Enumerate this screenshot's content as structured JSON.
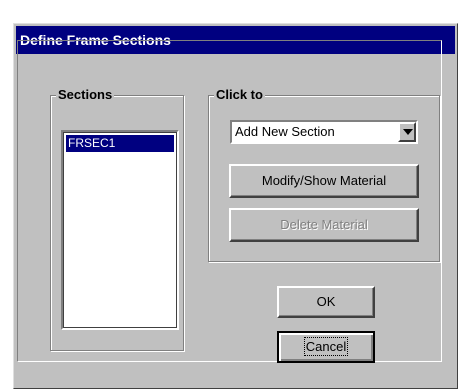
{
  "window": {
    "title": "Define Frame Sections"
  },
  "sections": {
    "label": "Sections",
    "items": [
      "FRSEC1"
    ],
    "selected": "FRSEC1"
  },
  "click_to": {
    "label": "Click to",
    "dropdown_value": "Add New Section",
    "modify_label": "Modify/Show Material",
    "delete_label": "Delete Material"
  },
  "footer": {
    "ok_label": "OK",
    "cancel_label": "Cancel"
  }
}
